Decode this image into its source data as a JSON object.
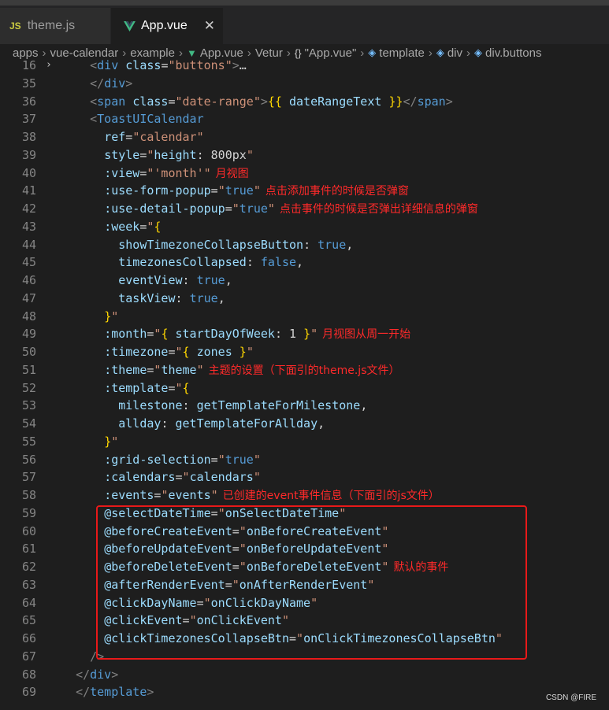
{
  "tabs": [
    {
      "icon": "JS",
      "label": "theme.js"
    },
    {
      "label": "App.vue",
      "close": "✕"
    }
  ],
  "breadcrumb": [
    "apps",
    "vue-calendar",
    "example",
    "App.vue",
    "Vetur",
    "\"App.vue\"",
    "template",
    "div",
    "div.buttons"
  ],
  "colors": {
    "tag": "#569cd6",
    "attr": "#9cdcfe",
    "string": "#ce9178",
    "punct": "#808080",
    "text": "#d4d4d4",
    "annotation": "#ff2a2a",
    "keyword": "#569cd6"
  },
  "lines": [
    {
      "n": "16",
      "fold": true,
      "html": "  <span class='p'>&lt;</span><span class='t'>div</span> <span class='a'>class</span><span class='x'>=</span><span class='s'>\"buttons\"</span><span class='p'>&gt;</span><span class='x'>…</span>"
    },
    {
      "n": "35",
      "html": "  <span class='p'>&lt;/</span><span class='t'>div</span><span class='p'>&gt;</span>"
    },
    {
      "n": "36",
      "html": "  <span class='p'>&lt;</span><span class='t'>span</span> <span class='a'>class</span><span class='x'>=</span><span class='s'>\"date-range\"</span><span class='p'>&gt;</span><span class='y'>{{</span><span class='a'> dateRangeText </span><span class='y'>}}</span><span class='p'>&lt;/</span><span class='t'>span</span><span class='p'>&gt;</span>"
    },
    {
      "n": "37",
      "html": "  <span class='p'>&lt;</span><span class='t'>ToastUICalendar</span>"
    },
    {
      "n": "38",
      "html": "    <span class='a'>ref</span><span class='x'>=</span><span class='s'>\"calendar\"</span>"
    },
    {
      "n": "39",
      "html": "    <span class='a'>style</span><span class='x'>=</span><span class='s'>\"</span><span class='a'>height</span><span class='x'>: 800px</span><span class='s'>\"</span>"
    },
    {
      "n": "40",
      "html": "    <span class='a'>:view</span><span class='x'>=</span><span class='s'>\"'month'\"</span>",
      "note": "月视图"
    },
    {
      "n": "41",
      "html": "    <span class='a'>:use-form-popup</span><span class='x'>=</span><span class='s'>\"</span><span class='k'>true</span><span class='s'>\"</span>",
      "note": "点击添加事件的时候是否弹窗"
    },
    {
      "n": "42",
      "html": "    <span class='a'>:use-detail-popup</span><span class='x'>=</span><span class='s'>\"</span><span class='k'>true</span><span class='s'>\"</span>",
      "note": "点击事件的时候是否弹出详细信息的弹窗"
    },
    {
      "n": "43",
      "html": "    <span class='a'>:week</span><span class='x'>=</span><span class='s'>\"</span><span class='y'>{</span>"
    },
    {
      "n": "44",
      "html": "      <span class='a'>showTimezoneCollapseButton</span><span class='x'>: </span><span class='k'>true</span><span class='x'>,</span>"
    },
    {
      "n": "45",
      "html": "      <span class='a'>timezonesCollapsed</span><span class='x'>: </span><span class='k'>false</span><span class='x'>,</span>"
    },
    {
      "n": "46",
      "html": "      <span class='a'>eventView</span><span class='x'>: </span><span class='k'>true</span><span class='x'>,</span>"
    },
    {
      "n": "47",
      "html": "      <span class='a'>taskView</span><span class='x'>: </span><span class='k'>true</span><span class='x'>,</span>"
    },
    {
      "n": "48",
      "html": "    <span class='y'>}</span><span class='s'>\"</span>"
    },
    {
      "n": "49",
      "html": "    <span class='a'>:month</span><span class='x'>=</span><span class='s'>\"</span><span class='y'>{</span><span class='a'> startDayOfWeek</span><span class='x'>: 1 </span><span class='y'>}</span><span class='s'>\"</span>",
      "note": "月视图从周一开始"
    },
    {
      "n": "50",
      "html": "    <span class='a'>:timezone</span><span class='x'>=</span><span class='s'>\"</span><span class='y'>{</span><span class='a'> zones </span><span class='y'>}</span><span class='s'>\"</span>"
    },
    {
      "n": "51",
      "html": "    <span class='a'>:theme</span><span class='x'>=</span><span class='s'>\"</span><span class='a'>theme</span><span class='s'>\"</span>",
      "note": "主题的设置（下面引的theme.js文件）"
    },
    {
      "n": "52",
      "html": "    <span class='a'>:template</span><span class='x'>=</span><span class='s'>\"</span><span class='y'>{</span>"
    },
    {
      "n": "53",
      "html": "      <span class='a'>milestone</span><span class='x'>: </span><span class='a'>getTemplateForMilestone</span><span class='x'>,</span>"
    },
    {
      "n": "54",
      "html": "      <span class='a'>allday</span><span class='x'>: </span><span class='a'>getTemplateForAllday</span><span class='x'>,</span>"
    },
    {
      "n": "55",
      "html": "    <span class='y'>}</span><span class='s'>\"</span>"
    },
    {
      "n": "56",
      "html": "    <span class='a'>:grid-selection</span><span class='x'>=</span><span class='s'>\"</span><span class='k'>true</span><span class='s'>\"</span>"
    },
    {
      "n": "57",
      "html": "    <span class='a'>:calendars</span><span class='x'>=</span><span class='s'>\"</span><span class='a'>calendars</span><span class='s'>\"</span>"
    },
    {
      "n": "58",
      "html": "    <span class='a'>:events</span><span class='x'>=</span><span class='s'>\"</span><span class='a'>events</span><span class='s'>\"</span>",
      "note": "已创建的event事件信息（下面引的js文件）"
    },
    {
      "n": "59",
      "html": "    <span class='a'>@selectDateTime</span><span class='x'>=</span><span class='s'>\"</span><span class='a'>onSelectDateTime</span><span class='s'>\"</span>"
    },
    {
      "n": "60",
      "html": "    <span class='a'>@beforeCreateEvent</span><span class='x'>=</span><span class='s'>\"</span><span class='a'>onBeforeCreateEvent</span><span class='s'>\"</span>"
    },
    {
      "n": "61",
      "html": "    <span class='a'>@beforeUpdateEvent</span><span class='x'>=</span><span class='s'>\"</span><span class='a'>onBeforeUpdateEvent</span><span class='s'>\"</span>"
    },
    {
      "n": "62",
      "html": "    <span class='a'>@beforeDeleteEvent</span><span class='x'>=</span><span class='s'>\"</span><span class='a'>onBeforeDeleteEvent</span><span class='s'>\"</span>",
      "note": "默认的事件"
    },
    {
      "n": "63",
      "html": "    <span class='a'>@afterRenderEvent</span><span class='x'>=</span><span class='s'>\"</span><span class='a'>onAfterRenderEvent</span><span class='s'>\"</span>"
    },
    {
      "n": "64",
      "html": "    <span class='a'>@clickDayName</span><span class='x'>=</span><span class='s'>\"</span><span class='a'>onClickDayName</span><span class='s'>\"</span>"
    },
    {
      "n": "65",
      "html": "    <span class='a'>@clickEvent</span><span class='x'>=</span><span class='s'>\"</span><span class='a'>onClickEvent</span><span class='s'>\"</span>"
    },
    {
      "n": "66",
      "html": "    <span class='a'>@clickTimezonesCollapseBtn</span><span class='x'>=</span><span class='s'>\"</span><span class='a'>onClickTimezonesCollapseBtn</span><span class='s'>\"</span>"
    },
    {
      "n": "67",
      "html": "  <span class='p'>/&gt;</span>"
    },
    {
      "n": "68",
      "html": "<span class='p'>&lt;/</span><span class='t'>div</span><span class='p'>&gt;</span>"
    },
    {
      "n": "69",
      "html": "<span class='p'>&lt;/</span><span class='t'>template</span><span class='p'>&gt;</span>"
    }
  ],
  "watermark": "CSDN @FIRE"
}
